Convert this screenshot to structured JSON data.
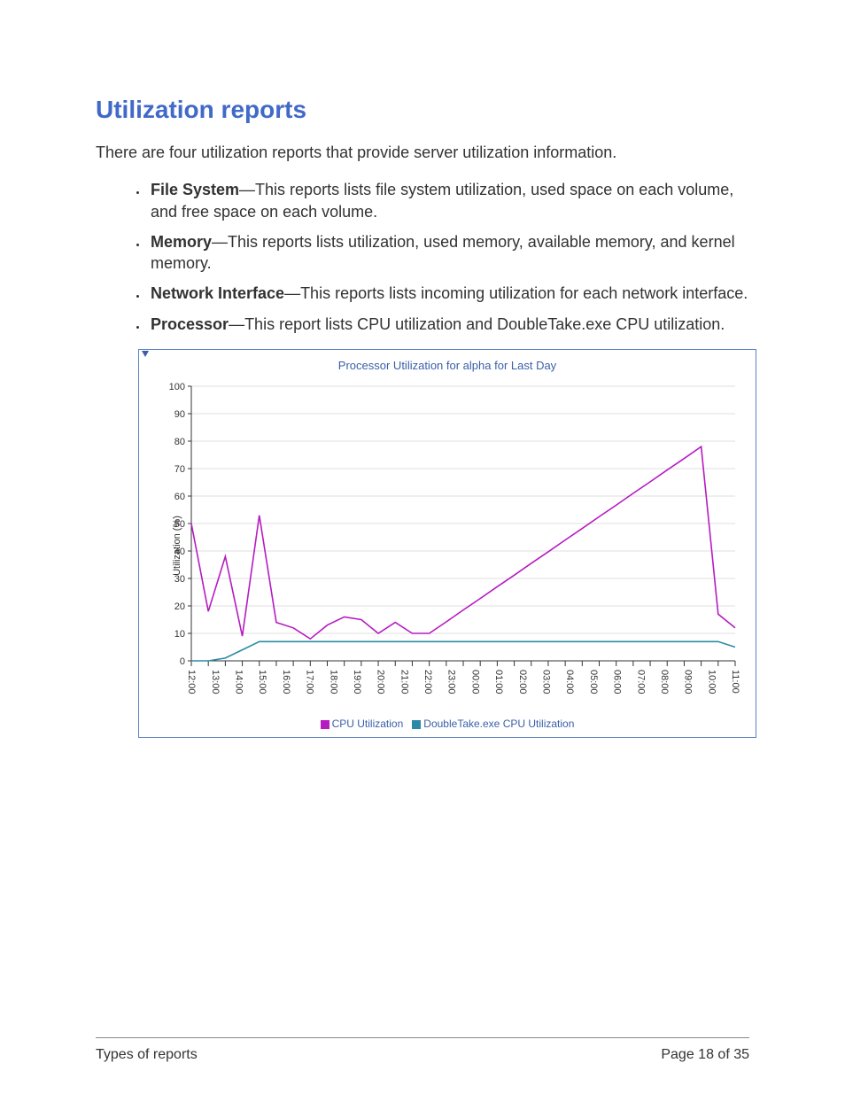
{
  "title": "Utilization reports",
  "intro": "There are four utilization reports that provide server utilization information.",
  "items": [
    {
      "name": "File System",
      "desc": "—This reports lists file system utilization, used space on each volume, and free space on each volume."
    },
    {
      "name": "Memory",
      "desc": "—This reports lists utilization, used memory, available memory, and kernel memory."
    },
    {
      "name": "Network Interface",
      "desc": "—This reports lists incoming utilization for each network interface."
    },
    {
      "name": "Processor",
      "desc": "—This report lists CPU utilization and DoubleTake.exe CPU utilization."
    }
  ],
  "chart_data": {
    "type": "line",
    "title": "Processor Utilization for alpha for Last Day",
    "ylabel": "Utilization (%)",
    "categories": [
      "12:00",
      "13:00",
      "14:00",
      "15:00",
      "16:00",
      "17:00",
      "18:00",
      "19:00",
      "20:00",
      "21:00",
      "22:00",
      "23:00",
      "00:00",
      "01:00",
      "02:00",
      "03:00",
      "04:00",
      "05:00",
      "06:00",
      "07:00",
      "08:00",
      "09:00",
      "10:00",
      "11:00"
    ],
    "x_minor_per_major": 2,
    "ylim": [
      0,
      100
    ],
    "ytick": 10,
    "series": [
      {
        "name": "CPU Utilization",
        "color": "#b61bc2",
        "values": [
          50,
          18,
          38,
          9,
          53,
          14,
          12,
          8,
          13,
          16,
          15,
          10,
          14,
          10,
          10,
          14.2,
          18.5,
          22.7,
          27,
          31.2,
          35.5,
          39.7,
          44,
          48.2,
          52.5,
          56.7,
          61,
          65.2,
          69.5,
          73.7,
          78,
          17,
          12
        ]
      },
      {
        "name": "DoubleTake.exe CPU Utilization",
        "color": "#2b8aa6",
        "values": [
          0,
          0,
          1,
          4,
          7,
          7,
          7,
          7,
          7,
          7,
          7,
          7,
          7,
          7,
          7,
          7,
          7,
          7,
          7,
          7,
          7,
          7,
          7,
          7,
          7,
          7,
          7,
          7,
          7,
          7,
          7,
          7,
          5
        ]
      }
    ]
  },
  "footer": {
    "left": "Types of reports",
    "right": "Page 18 of 35"
  }
}
